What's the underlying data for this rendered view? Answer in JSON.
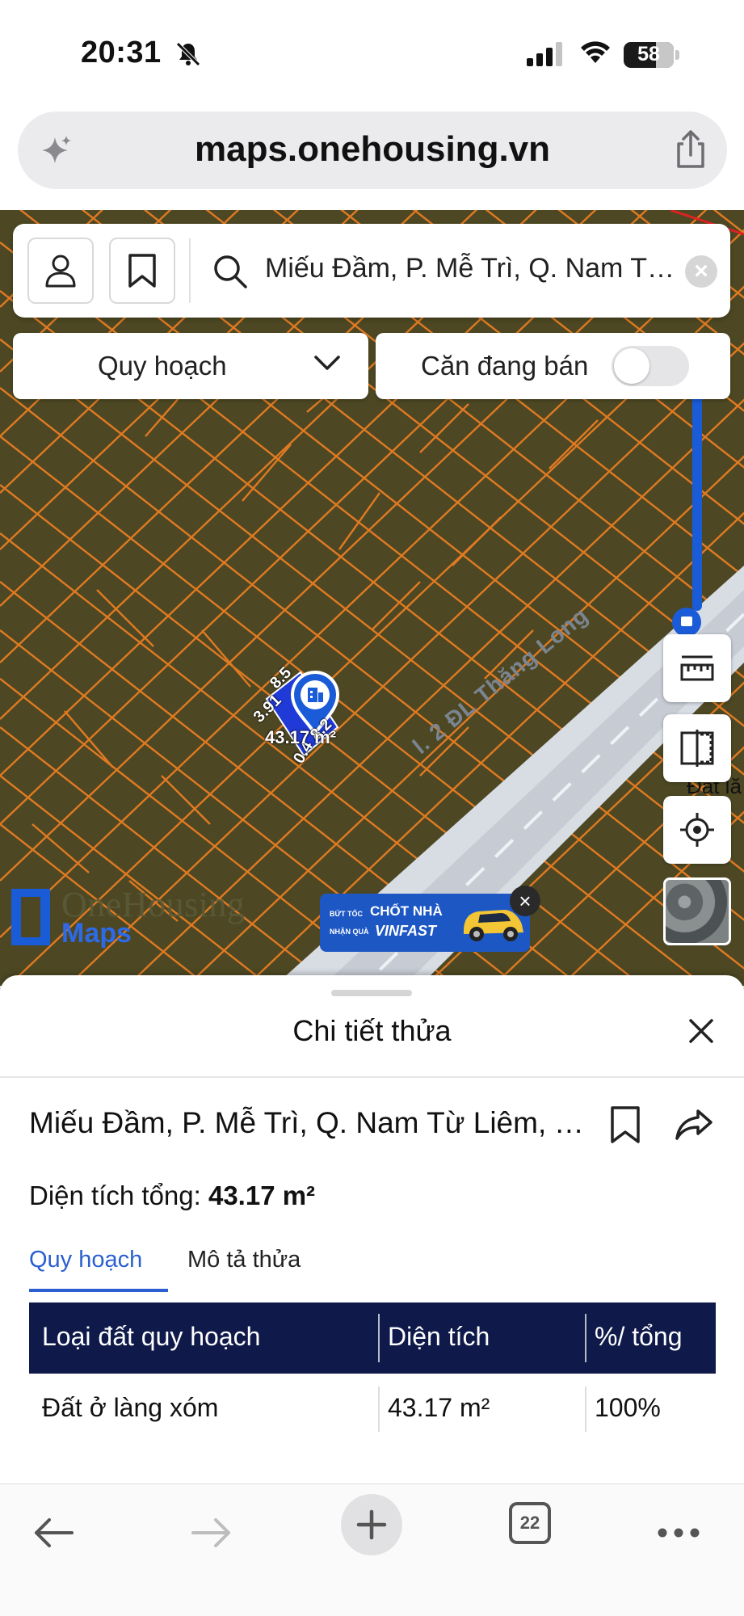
{
  "status_bar": {
    "time": "20:31",
    "battery": "58"
  },
  "browser": {
    "url": "maps.onehousing.vn",
    "tabs_count": "22"
  },
  "search": {
    "query": "Miếu Đầm, P. Mễ Trì, Q. Nam Từ Liêm, Thành phố Hà Nội"
  },
  "filters": {
    "dropdown_label": "Quy hoạch",
    "toggle_label": "Căn đang bán",
    "toggle_on": false
  },
  "map": {
    "road_label": "2 ĐL Thăng Long",
    "road_label_prefix": "l.",
    "side_label": "Đất lă",
    "parcel": {
      "area_label": "43.17 m²",
      "side_a": "3.91",
      "side_b": "8.5",
      "side_c": "8.2",
      "side_d": "0.4"
    },
    "logo_title": "OneHousing",
    "logo_sub": "Maps",
    "ad": {
      "line1": "BỨT TỐC",
      "headline": "CHỐT NHÀ",
      "line2": "NHẬN QUÀ",
      "brand": "VINFAST"
    },
    "colors": {
      "map_bg": "#4d4823",
      "parcel_lines": "#e07a22",
      "road": "#d8dde4",
      "accent": "#1a5bd8"
    }
  },
  "sheet": {
    "title": "Chi tiết thửa",
    "address": "Miếu Đầm, P. Mễ Trì, Q. Nam Từ Liêm, Thành phố Hà Nội",
    "area_prefix": "Diện tích tổng:",
    "area_value": "43.17 m²",
    "tabs": [
      {
        "label": "Quy hoạch",
        "active": true
      },
      {
        "label": "Mô tả thửa",
        "active": false
      }
    ],
    "table": {
      "headers": [
        "Loại đất quy hoạch",
        "Diện tích",
        "%/ tổng"
      ],
      "rows": [
        [
          "Đất ở làng xóm",
          "43.17 m²",
          "100%"
        ]
      ]
    }
  }
}
